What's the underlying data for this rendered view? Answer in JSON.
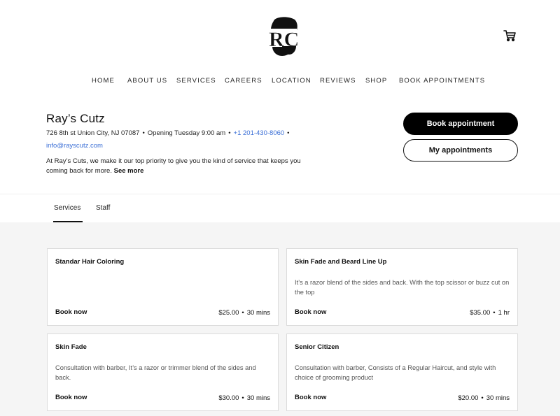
{
  "header": {
    "logo_icon": "rc-barber-logo",
    "cart_icon": "shopping-cart-icon"
  },
  "nav": {
    "items": [
      {
        "label": "HOME"
      },
      {
        "label": "ABOUT US"
      },
      {
        "label": "SERVICES"
      },
      {
        "label": "CAREERS"
      },
      {
        "label": "LOCATION"
      },
      {
        "label": "REVIEWS"
      },
      {
        "label": "SHOP"
      },
      {
        "label": "BOOK APPOINTMENTS"
      }
    ]
  },
  "business": {
    "name": "Ray’s Cutz",
    "address": "726 8th st Union City, NJ 07087",
    "hours": "Opening Tuesday 9:00 am",
    "phone": "+1 201-430-8060",
    "email": "info@rayscutz.com",
    "separator": "•",
    "description": "At Ray’s Cuts, we make it our top priority to give you the kind of service that keeps you coming back for more.",
    "see_more": "See more"
  },
  "actions": {
    "book_label": "Book appointment",
    "my_appointments_label": "My appointments"
  },
  "tabs": [
    {
      "label": "Services",
      "active": true
    },
    {
      "label": "Staff",
      "active": false
    }
  ],
  "services": [
    {
      "title": "Standar Hair Coloring",
      "description": "",
      "book_label": "Book now",
      "price": "$25.00",
      "duration": "30 mins"
    },
    {
      "title": "Skin Fade and Beard Line Up",
      "description": "It’s a razor blend of the sides and back. With the top scissor or buzz cut on the top",
      "book_label": "Book now",
      "price": "$35.00",
      "duration": "1 hr"
    },
    {
      "title": "Skin Fade",
      "description": "Consultation with barber, It’s a razor or trimmer blend of the sides and back.",
      "book_label": "Book now",
      "price": "$30.00",
      "duration": "30 mins"
    },
    {
      "title": "Senior Citizen",
      "description": "Consultation with barber, Consists of a Regular Haircut, and style with choice of grooming product",
      "book_label": "Book now",
      "price": "$20.00",
      "duration": "30 mins"
    }
  ],
  "colors": {
    "accent_link": "#3b6fd6",
    "primary_button": "#000000",
    "services_background": "#f5f5f5"
  }
}
